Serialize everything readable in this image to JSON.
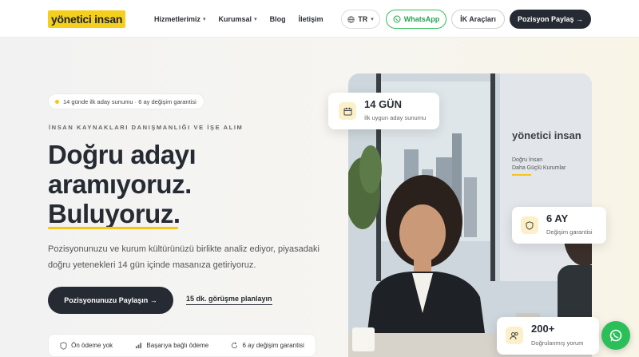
{
  "brand": {
    "logo_text": "yönetici insan"
  },
  "nav": {
    "items": [
      {
        "label": "Hizmetlerimiz",
        "dropdown": true
      },
      {
        "label": "Kurumsal",
        "dropdown": true
      },
      {
        "label": "Blog",
        "dropdown": false
      },
      {
        "label": "İletişim",
        "dropdown": false
      }
    ],
    "lang_label": "TR",
    "whatsapp_label": "WhatsApp",
    "ik_tools_label": "İK Araçları",
    "cta_label": "Pozisyon Paylaş →"
  },
  "hero": {
    "badge_text": "14 günde ilk aday sunumu · 6 ay değişim garantisi",
    "eyebrow": "İNSAN KAYNAKLARI DANIŞMANLIĞI VE İŞE ALIM",
    "headline": [
      "Doğru adayı",
      "aramıyoruz.",
      "Buluyoruz."
    ],
    "description": "Pozisyonunuzu ve kurum kültürünüzü birlikte analiz ediyor, piyasadaki doğru yetenekleri 14 gün içinde masanıza getiriyoruz.",
    "primary_button": "Pozisyonunuzu Paylaşın →",
    "secondary_link": "15 dk. görüşme planlayın",
    "trust_items": [
      "Ön ödeme yok",
      "Başarıya bağlı ödeme",
      "6 ay değişim garantisi"
    ]
  },
  "stats": {
    "card1": {
      "big": "14 GÜN",
      "small": "İlk uygun aday sunumu"
    },
    "card2": {
      "big": "6 AY",
      "small": "Değişim garantisi"
    },
    "card3": {
      "big": "200+",
      "small": "Doğrulanmış yorum"
    }
  },
  "photo_signage": {
    "brand": "yönetici insan",
    "line1": "Doğru İnsan",
    "line2": "Daha Güçlü Kurumlar"
  },
  "colors": {
    "accent": "#f5c518",
    "dark": "#262b33",
    "whatsapp": "#2bbf5a"
  },
  "icons": [
    "globe-icon",
    "whatsapp-icon",
    "calendar-icon",
    "shield-icon",
    "users-icon",
    "chart-icon",
    "refresh-icon"
  ]
}
